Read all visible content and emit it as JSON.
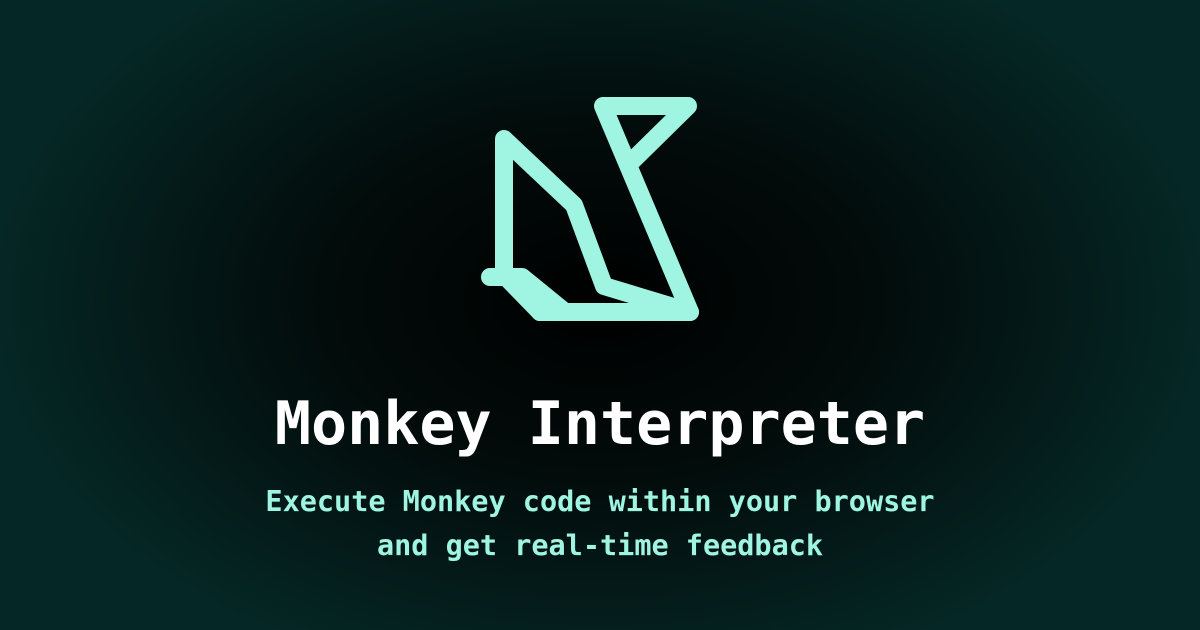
{
  "brand": {
    "logo_icon": "origami-monkey-logo-icon",
    "accent_color": "#9ff5e2",
    "background_color": "#000000"
  },
  "title": "Monkey Interpreter",
  "subtitle": {
    "line1": "Execute Monkey code within your browser",
    "line2": "and get real-time feedback"
  }
}
